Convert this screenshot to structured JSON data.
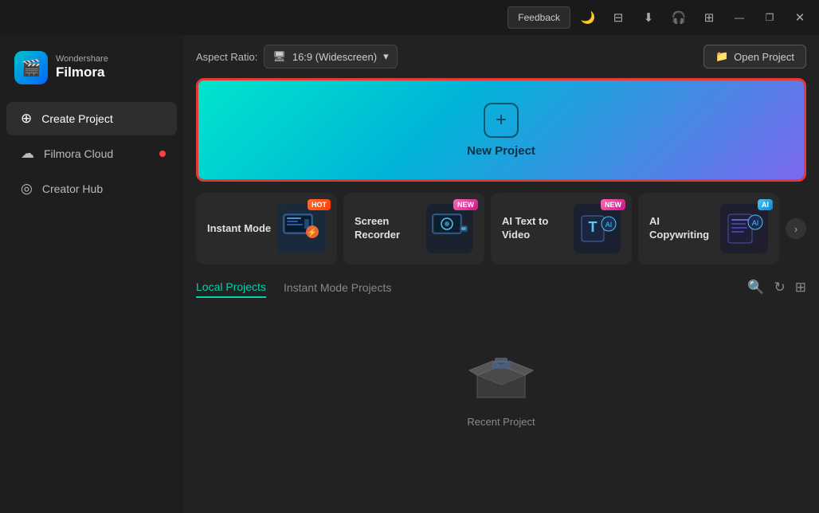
{
  "titlebar": {
    "feedback_label": "Feedback",
    "minimize_icon": "—",
    "maximize_icon": "❐",
    "close_icon": "✕"
  },
  "sidebar": {
    "brand_top": "Wondershare",
    "brand_name": "Filmora",
    "items": [
      {
        "id": "create-project",
        "label": "Create Project",
        "icon": "⊕",
        "active": true
      },
      {
        "id": "filmora-cloud",
        "label": "Filmora Cloud",
        "icon": "☁",
        "active": false,
        "notification": true
      },
      {
        "id": "creator-hub",
        "label": "Creator Hub",
        "icon": "◎",
        "active": false
      }
    ]
  },
  "main": {
    "aspect_ratio_label": "Aspect Ratio:",
    "aspect_ratio_value": "16:9 (Widescreen)",
    "open_project_label": "Open Project",
    "new_project_label": "New Project",
    "tools": [
      {
        "id": "instant-mode",
        "name": "Instant Mode",
        "badge": "HOT",
        "badge_type": "hot"
      },
      {
        "id": "screen-recorder",
        "name": "Screen Recorder",
        "badge": "NEW",
        "badge_type": "new"
      },
      {
        "id": "ai-text-to-video",
        "name": "AI Text to Video",
        "badge": "NEW",
        "badge_type": "new"
      },
      {
        "id": "ai-copywriting",
        "name": "AI Copywriting",
        "badge": "AI",
        "badge_type": "ai"
      }
    ],
    "tabs": [
      {
        "id": "local-projects",
        "label": "Local Projects",
        "active": true
      },
      {
        "id": "instant-mode-projects",
        "label": "Instant Mode Projects",
        "active": false
      }
    ],
    "empty_state_label": "Recent Project"
  }
}
